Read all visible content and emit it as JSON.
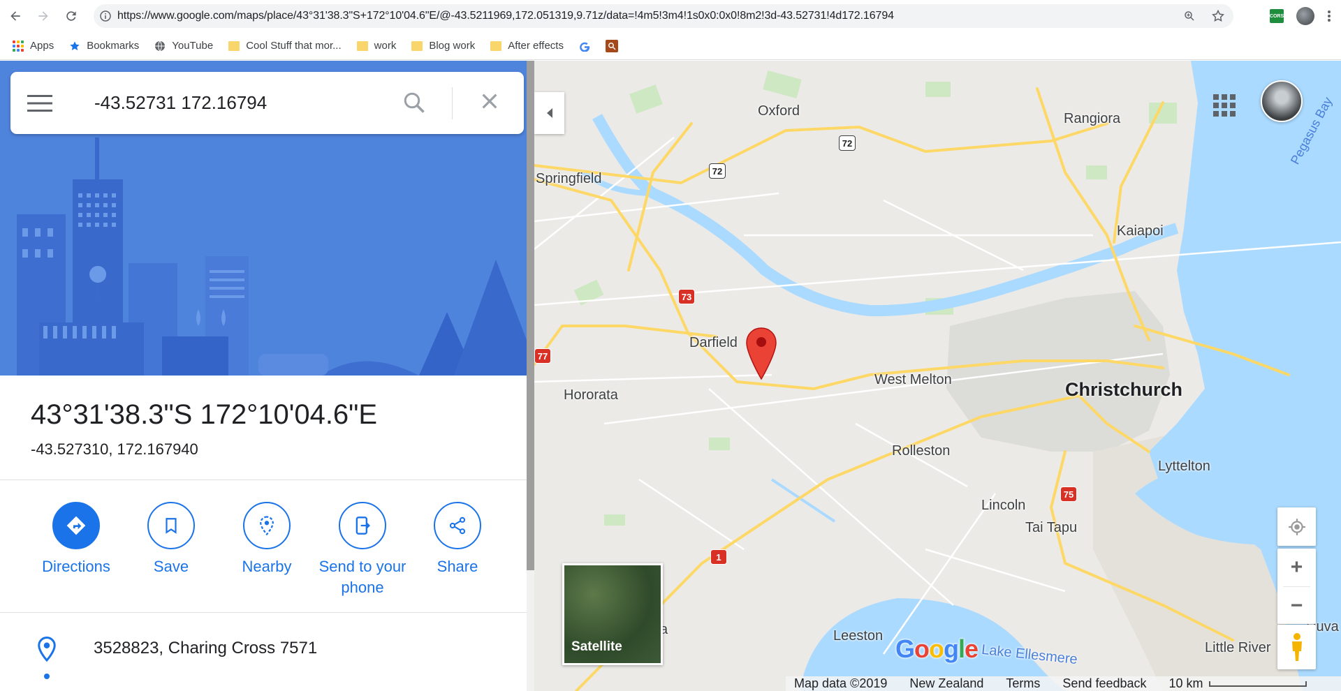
{
  "browser": {
    "url": "https://www.google.com/maps/place/43°31'38.3\"S+172°10'04.6\"E/@-43.5211969,172.051319,9.71z/data=!4m5!3m4!1s0x0:0x0!8m2!3d-43.52731!4d172.16794",
    "extension_label": "CORS",
    "bookmarks": [
      {
        "label": "Apps",
        "icon": "apps-grid-icon"
      },
      {
        "label": "Bookmarks",
        "icon": "star-icon"
      },
      {
        "label": "YouTube",
        "icon": "globe-icon"
      },
      {
        "label": "Cool Stuff that mor...",
        "icon": "folder-icon"
      },
      {
        "label": "work",
        "icon": "folder-icon"
      },
      {
        "label": "Blog work",
        "icon": "folder-icon"
      },
      {
        "label": "After effects",
        "icon": "folder-icon"
      }
    ]
  },
  "search": {
    "value": "-43.52731 172.16794"
  },
  "place": {
    "title": "43°31'38.3\"S 172°10'04.6\"E",
    "decimal": "-43.527310, 172.167940",
    "address": "3528823, Charing Cross 7571"
  },
  "actions": [
    {
      "label": "Directions",
      "icon": "directions-icon"
    },
    {
      "label": "Save",
      "icon": "bookmark-icon"
    },
    {
      "label": "Nearby",
      "icon": "nearby-icon"
    },
    {
      "label": "Send to your phone",
      "icon": "send-to-phone-icon"
    },
    {
      "label": "Share",
      "icon": "share-icon"
    }
  ],
  "map": {
    "places": {
      "oxford": "Oxford",
      "rangiora": "Rangiora",
      "springfield": "Springfield",
      "kaiapoi": "Kaiapoi",
      "darfield": "Darfield",
      "west_melton": "West Melton",
      "hororata": "Hororata",
      "christchurch": "Christchurch",
      "rolleston": "Rolleston",
      "lyttelton": "Lyttelton",
      "lincoln": "Lincoln",
      "tai_tapu": "Tai Tapu",
      "leeston": "Leeston",
      "lake_ellesmere": "Lake Ellesmere",
      "little_river": "Little River",
      "pegasus_bay": "Pegasus Bay",
      "duvauchelle": "Duva",
      "partial_a": "a"
    },
    "shields": {
      "r72a": "72",
      "r72b": "72",
      "r73": "73",
      "r77": "77",
      "r75": "75",
      "r1": "1"
    },
    "satellite_label": "Satellite",
    "zoom_in": "+",
    "zoom_out": "−",
    "logo": "Google",
    "footer": {
      "map_data": "Map data ©2019",
      "country": "New Zealand",
      "terms": "Terms",
      "feedback": "Send feedback",
      "scale": "10 km"
    }
  },
  "colors": {
    "accent": "#1a73e8",
    "hero_blue": "#4a7fd9",
    "water": "#aadaff",
    "road": "#fdd867",
    "pin": "#ea4335"
  }
}
